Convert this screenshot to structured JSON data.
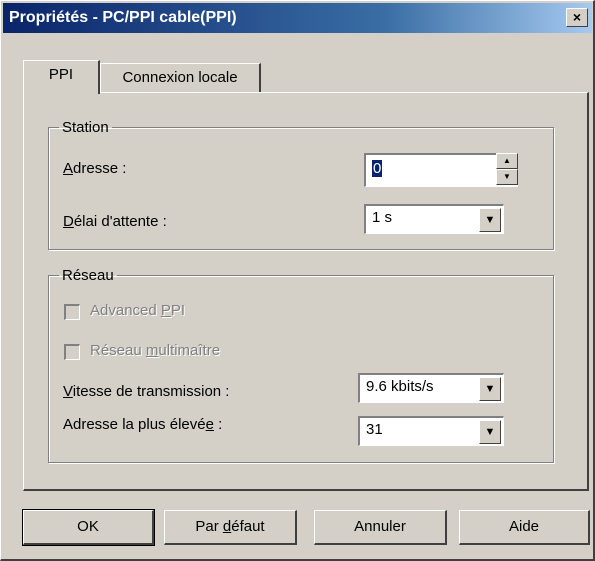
{
  "window": {
    "title": "Propriétés - PC/PPI cable(PPI)",
    "close_glyph": "×"
  },
  "tabs": [
    {
      "label": "PPI",
      "active": true
    },
    {
      "label": "Connexion locale",
      "active": false
    }
  ],
  "station": {
    "legend": "Station",
    "address_label_u": "A",
    "address_label_rest": "dresse :",
    "address_value": "0",
    "timeout_label_u": "D",
    "timeout_label_rest": "élai d'attente :",
    "timeout_value": "1 s"
  },
  "network": {
    "legend": "Réseau",
    "advanced_ppi_a": "Advanced ",
    "advanced_ppi_u": "P",
    "advanced_ppi_b": "PI",
    "multimaster_a": "Réseau ",
    "multimaster_u": "m",
    "multimaster_b": "ultimaître",
    "speed_label_u": "V",
    "speed_label_rest": "itesse de transmission :",
    "speed_value": "9.6 kbits/s",
    "highest_label_a": "Adresse la plus élevé",
    "highest_label_u": "e",
    "highest_label_b": " :",
    "highest_value": "31"
  },
  "buttons": {
    "ok": "OK",
    "default_a": "Par ",
    "default_u": "d",
    "default_b": "éfaut",
    "cancel": "Annuler",
    "help": "Aide"
  },
  "icons": {
    "spin_up": "▲",
    "spin_down": "▼",
    "dropdown": "▼"
  }
}
